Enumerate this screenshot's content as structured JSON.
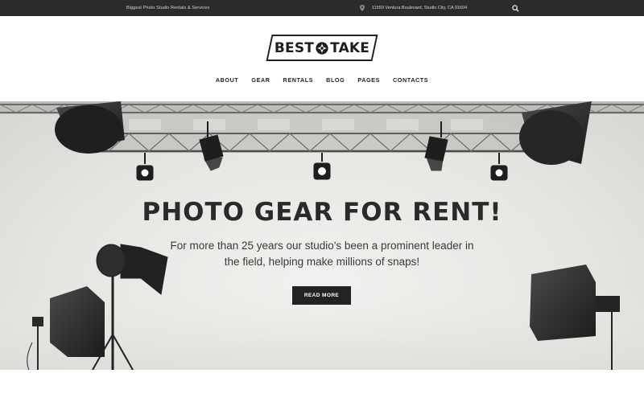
{
  "topbar": {
    "tagline": "Biggest Photo Studio Rentals & Services",
    "address": "11559 Ventura Boulevard, Studio City, CA 91604",
    "icons": {
      "location": "map-pin-icon",
      "search": "search-icon"
    }
  },
  "logo": {
    "left": "BEST",
    "right": "TAKE",
    "icon": "camera-aperture-icon"
  },
  "nav": [
    {
      "label": "ABOUT"
    },
    {
      "label": "GEAR"
    },
    {
      "label": "RENTALS"
    },
    {
      "label": "BLOG"
    },
    {
      "label": "PAGES"
    },
    {
      "label": "CONTACTS"
    }
  ],
  "hero": {
    "title": "PHOTO GEAR FOR RENT!",
    "subtitle": "For more than 25 years our studio's been a prominent leader in the field, helping make millions of snaps!",
    "button": "READ MORE"
  },
  "colors": {
    "topbar_bg": "#2b2b2b",
    "button_bg": "#232323",
    "text_dark": "#222222"
  }
}
